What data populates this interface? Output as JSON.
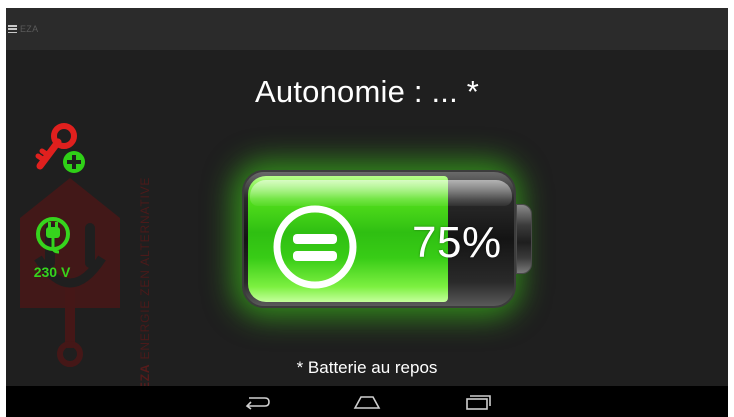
{
  "app": {
    "name": "EZA"
  },
  "main": {
    "title": "Autonomie :  ... *",
    "battery_percent": "75%",
    "battery_level": 0.75,
    "footnote": "* Batterie au repos"
  },
  "side": {
    "plug_label": "230 V",
    "key_icon": "key-add-icon",
    "plug_icon": "plug-icon"
  },
  "watermark": {
    "brand": "EZA",
    "tagline": " ENERGIE ZEN ALTERNATIVE"
  },
  "nav": {
    "back_icon": "back-icon",
    "home_icon": "home-icon",
    "recents_icon": "recents-icon"
  },
  "colors": {
    "background": "#1f1f1f",
    "topbar": "#2b2b2b",
    "accent_green": "#36d41d",
    "key_red": "#e0201e",
    "watermark": "#4a1a1a"
  }
}
